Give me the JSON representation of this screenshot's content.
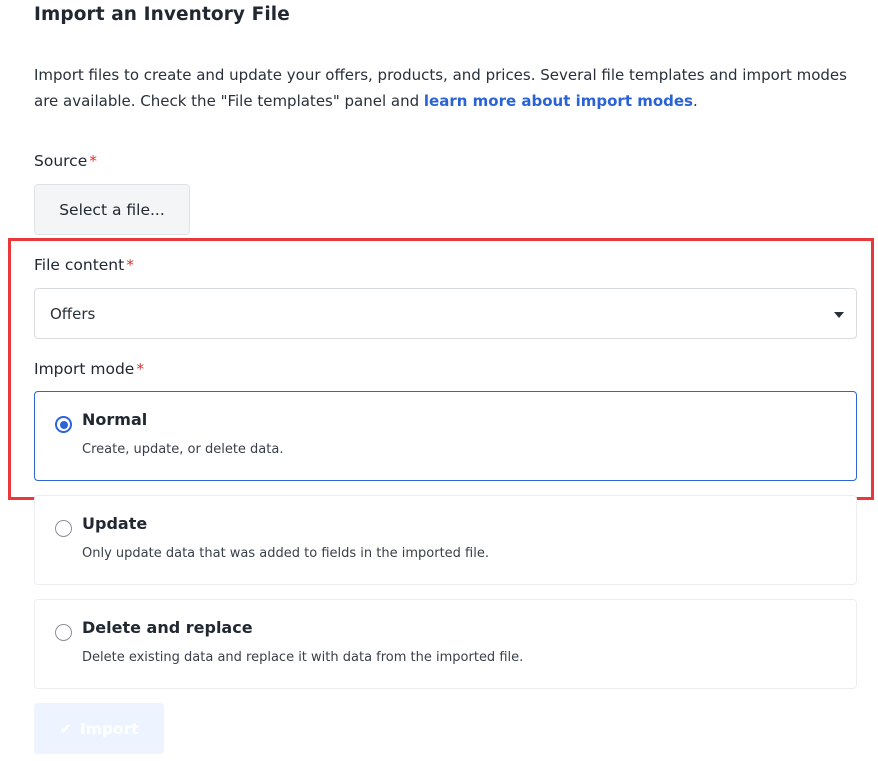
{
  "header": {
    "title": "Import an Inventory File"
  },
  "intro": {
    "text": "Import files to create and update your offers, products, and prices. Several file templates and import modes are available. Check the \"File templates\" panel and ",
    "link": "learn more about import modes",
    "suffix": "."
  },
  "source": {
    "label": "Source",
    "required_mark": "*",
    "button_label": "Select a file..."
  },
  "file_content": {
    "label": "File content",
    "required_mark": "*",
    "selected": "Offers"
  },
  "import_mode": {
    "label": "Import mode",
    "required_mark": "*",
    "selected": "Normal",
    "options": [
      {
        "title": "Normal",
        "description": "Create, update, or delete data."
      },
      {
        "title": "Update",
        "description": "Only update data that was added to fields in the imported file."
      },
      {
        "title": "Delete and replace",
        "description": "Delete existing data and replace it with data from the imported file."
      }
    ]
  },
  "actions": {
    "import_label": "Import",
    "import_icon": "check-icon"
  },
  "colors": {
    "accent": "#2f63d6",
    "required": "#e0322b",
    "highlight": "#e8383b",
    "link": "#2a63d4"
  }
}
